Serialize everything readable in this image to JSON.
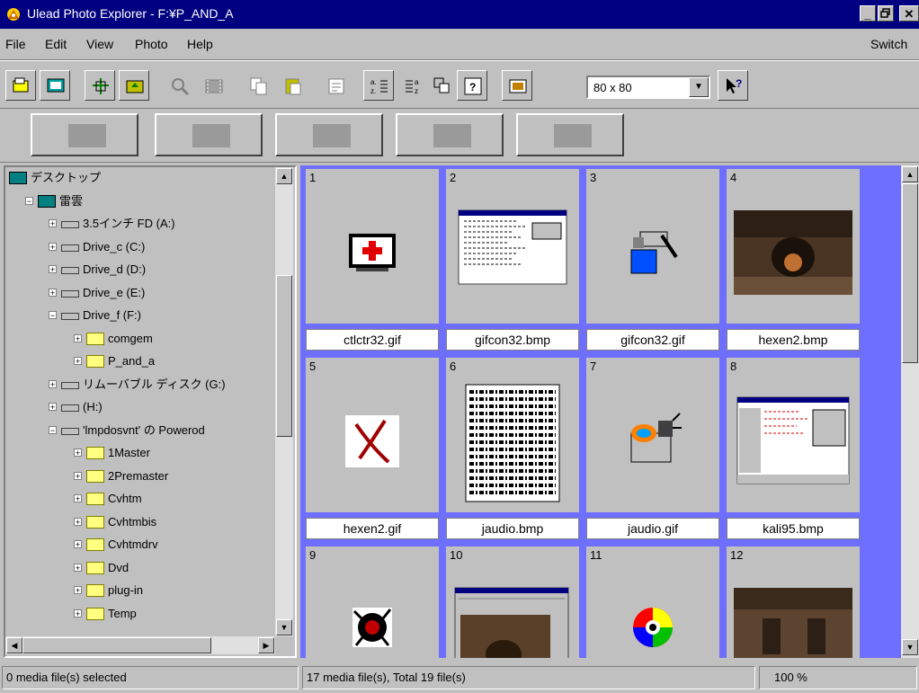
{
  "window": {
    "title": "Ulead Photo Explorer - F:¥P_AND_A",
    "controls": [
      "_",
      "🗗",
      "✕"
    ]
  },
  "menu": {
    "file": "File",
    "edit": "Edit",
    "view": "View",
    "photo": "Photo",
    "help": "Help",
    "switch": "Switch"
  },
  "toolbar": {
    "thumb_size": "80 x 80",
    "icons": [
      "open-icon",
      "slideshow-icon",
      "cascade-icon",
      "up-folder-icon",
      "zoom-icon",
      "film-icon",
      "copy-icon",
      "paste-icon",
      "properties-icon",
      "sort-asc-icon",
      "sort-desc-icon",
      "view-icon",
      "info-icon",
      "thumbnail-view-icon",
      "help-pointer-icon"
    ]
  },
  "big_tools": [
    "hand-tool",
    "folder-tool",
    "clapper-tool",
    "monitor-tool",
    "film-strip-tool"
  ],
  "tree": {
    "items": [
      {
        "label": "デスクトップ",
        "level": 0,
        "expander": "",
        "icon": "desktop"
      },
      {
        "label": "雷雲",
        "level": 1,
        "expander": "−",
        "icon": "network"
      },
      {
        "label": "3.5インチ FD (A:)",
        "level": 2,
        "expander": "+",
        "icon": "floppy"
      },
      {
        "label": "Drive_c (C:)",
        "level": 2,
        "expander": "+",
        "icon": "drive"
      },
      {
        "label": "Drive_d (D:)",
        "level": 2,
        "expander": "+",
        "icon": "drive"
      },
      {
        "label": "Drive_e (E:)",
        "level": 2,
        "expander": "+",
        "icon": "drive"
      },
      {
        "label": "Drive_f (F:)",
        "level": 2,
        "expander": "−",
        "icon": "drive"
      },
      {
        "label": "comgem",
        "level": 3,
        "expander": "+",
        "icon": "folder"
      },
      {
        "label": "P_and_a",
        "level": 3,
        "expander": "+",
        "icon": "folder-open"
      },
      {
        "label": "リムーバブル ディスク (G:)",
        "level": 2,
        "expander": "+",
        "icon": "removable"
      },
      {
        "label": "(H:)",
        "level": 2,
        "expander": "+",
        "icon": "cdrom"
      },
      {
        "label": "'lmpdosvnt' の Powerod",
        "level": 2,
        "expander": "−",
        "icon": "netdrive"
      },
      {
        "label": "1Master",
        "level": 3,
        "expander": "+",
        "icon": "folder"
      },
      {
        "label": "2Premaster",
        "level": 3,
        "expander": "+",
        "icon": "folder"
      },
      {
        "label": "Cvhtm",
        "level": 3,
        "expander": "+",
        "icon": "folder"
      },
      {
        "label": "Cvhtmbis",
        "level": 3,
        "expander": "+",
        "icon": "folder"
      },
      {
        "label": "Cvhtmdrv",
        "level": 3,
        "expander": "+",
        "icon": "folder"
      },
      {
        "label": "Dvd",
        "level": 3,
        "expander": "+",
        "icon": "folder"
      },
      {
        "label": "plug-in",
        "level": 3,
        "expander": "+",
        "icon": "folder"
      },
      {
        "label": "Temp",
        "level": 3,
        "expander": "+",
        "icon": "folder"
      }
    ]
  },
  "thumbnails": [
    {
      "num": "1",
      "name": "ctlctr32.gif",
      "kind": "medkit"
    },
    {
      "num": "2",
      "name": "gifcon32.bmp",
      "kind": "screenshot"
    },
    {
      "num": "3",
      "name": "gifcon32.gif",
      "kind": "tools"
    },
    {
      "num": "4",
      "name": "hexen2.bmp",
      "kind": "dungeon"
    },
    {
      "num": "5",
      "name": "hexen2.gif",
      "kind": "redx"
    },
    {
      "num": "6",
      "name": "jaudio.bmp",
      "kind": "dense"
    },
    {
      "num": "7",
      "name": "jaudio.gif",
      "kind": "audio"
    },
    {
      "num": "8",
      "name": "kali95.bmp",
      "kind": "screenshot2"
    },
    {
      "num": "9",
      "name": "",
      "kind": "splat"
    },
    {
      "num": "10",
      "name": "",
      "kind": "gamescreen"
    },
    {
      "num": "11",
      "name": "",
      "kind": "colorwheel"
    },
    {
      "num": "12",
      "name": "",
      "kind": "dungeon2"
    }
  ],
  "status": {
    "selected": "0 media file(s) selected",
    "total": "17 media file(s), Total 19 file(s)",
    "zoom": "100 %"
  },
  "colors": {
    "titlebar": "#000080",
    "face": "#c0c0c0",
    "thumb_bg": "#6f6fff"
  }
}
